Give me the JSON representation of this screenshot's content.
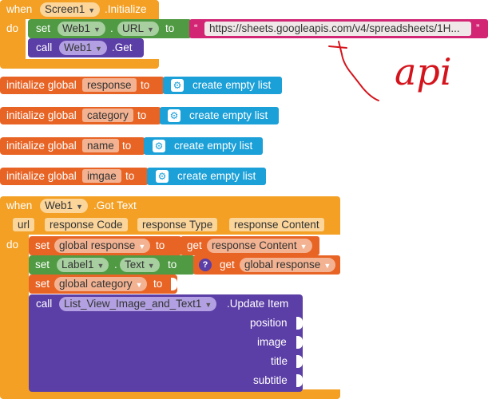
{
  "screen_init": {
    "when": "when",
    "component": "Screen1",
    "event": ".Initialize",
    "do": "do",
    "set": "set",
    "web_component": "Web1",
    "dot": ".",
    "property": "URL",
    "to": "to",
    "url_value": "https://sheets.googleapis.com/v4/spreadsheets/1H...",
    "quote_open": "“",
    "quote_close": "”",
    "call": "call",
    "method": ".Get"
  },
  "globals": [
    {
      "prefix": "initialize global",
      "name": "response",
      "to": "to",
      "value": "create empty list"
    },
    {
      "prefix": "initialize global",
      "name": "category",
      "to": "to",
      "value": "create empty list"
    },
    {
      "prefix": "initialize global",
      "name": "name",
      "to": "to",
      "value": "create empty list"
    },
    {
      "prefix": "initialize global",
      "name": "imgae",
      "to": "to",
      "value": "create empty list"
    }
  ],
  "got_text": {
    "when": "when",
    "component": "Web1",
    "event": ".Got Text",
    "params": [
      "url",
      "response Code",
      "response Type",
      "response Content"
    ],
    "do": "do",
    "set1": {
      "set": "set",
      "var": "global response",
      "to": "to",
      "get": "get",
      "value": "response Content"
    },
    "set2": {
      "set": "set",
      "component": "Label1",
      "dot": ".",
      "property": "Text",
      "to": "to",
      "q": "?",
      "get": "get",
      "value": "global response"
    },
    "set3": {
      "set": "set",
      "var": "global category",
      "to": "to"
    },
    "call": {
      "call": "call",
      "component": "List_View_Image_and_Text1",
      "method": ".Update Item",
      "args": [
        "position",
        "image",
        "title",
        "subtitle"
      ]
    }
  },
  "annotation": {
    "text": "api",
    "color": "#d4141c"
  },
  "colors": {
    "event": "#f3a024",
    "variable": "#e86425",
    "component_set": "#4f9a43",
    "component_call": "#5b3ea6",
    "list": "#1ba0d8",
    "text": "#d22675"
  }
}
